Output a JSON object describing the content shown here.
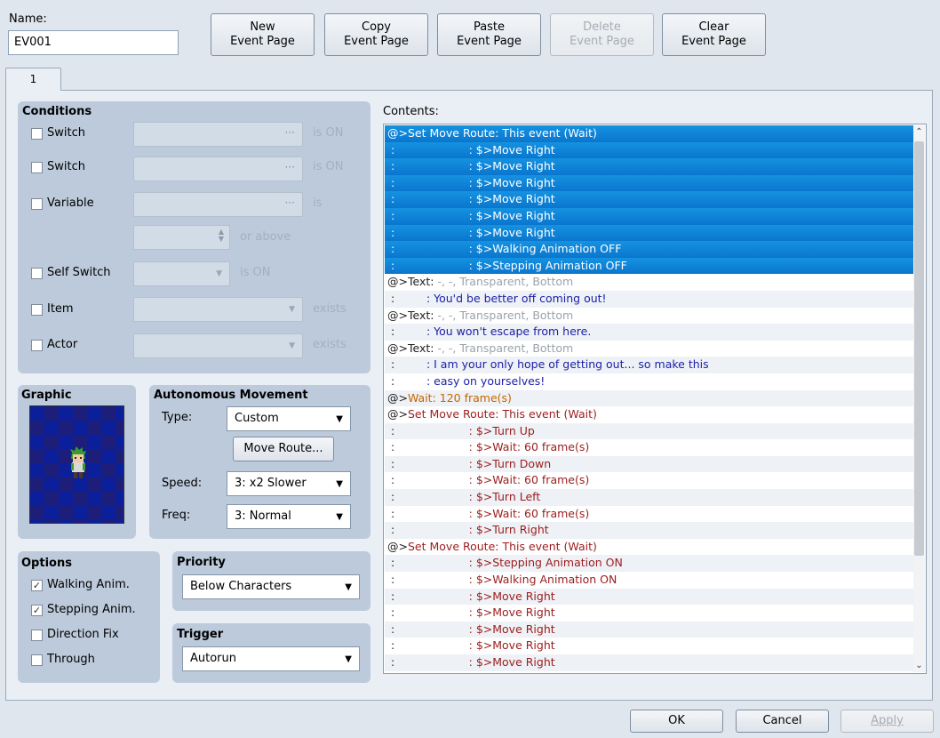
{
  "name": {
    "label": "Name:",
    "value": "EV001"
  },
  "toolbar": {
    "new": "New\nEvent Page",
    "copy": "Copy\nEvent Page",
    "paste": "Paste\nEvent Page",
    "delete": "Delete\nEvent Page",
    "clear": "Clear\nEvent Page"
  },
  "tab": {
    "label": "1"
  },
  "conditions": {
    "title": "Conditions",
    "switch1": {
      "label": "Switch",
      "suffix": "is ON"
    },
    "switch2": {
      "label": "Switch",
      "suffix": "is ON"
    },
    "variable": {
      "label": "Variable",
      "suffix": "is",
      "above": "or above"
    },
    "self_switch": {
      "label": "Self Switch",
      "suffix": "is ON"
    },
    "item": {
      "label": "Item",
      "suffix": "exists"
    },
    "actor": {
      "label": "Actor",
      "suffix": "exists"
    }
  },
  "graphic": {
    "title": "Graphic"
  },
  "movement": {
    "title": "Autonomous Movement",
    "type_label": "Type:",
    "type_value": "Custom",
    "route_button": "Move Route...",
    "speed_label": "Speed:",
    "speed_value": "3: x2 Slower",
    "freq_label": "Freq:",
    "freq_value": "3: Normal"
  },
  "options": {
    "title": "Options",
    "walking": {
      "label": "Walking Anim.",
      "checked": "✓"
    },
    "stepping": {
      "label": "Stepping Anim.",
      "checked": "✓"
    },
    "direction": {
      "label": "Direction Fix",
      "checked": ""
    },
    "through": {
      "label": "Through",
      "checked": ""
    }
  },
  "priority": {
    "title": "Priority",
    "value": "Below Characters"
  },
  "trigger": {
    "title": "Trigger",
    "value": "Autorun"
  },
  "contents": {
    "label": "Contents:",
    "rows": [
      {
        "sel": true,
        "parts": [
          {
            "t": "@>Set Move Route: This event (Wait)",
            "c": ""
          }
        ]
      },
      {
        "sel": true,
        "parts": [
          {
            "t": " :                     : $>Move Right",
            "c": ""
          }
        ]
      },
      {
        "sel": true,
        "parts": [
          {
            "t": " :                     : $>Move Right",
            "c": ""
          }
        ]
      },
      {
        "sel": true,
        "parts": [
          {
            "t": " :                     : $>Move Right",
            "c": ""
          }
        ]
      },
      {
        "sel": true,
        "parts": [
          {
            "t": " :                     : $>Move Right",
            "c": ""
          }
        ]
      },
      {
        "sel": true,
        "parts": [
          {
            "t": " :                     : $>Move Right",
            "c": ""
          }
        ]
      },
      {
        "sel": true,
        "parts": [
          {
            "t": " :                     : $>Move Right",
            "c": ""
          }
        ]
      },
      {
        "sel": true,
        "parts": [
          {
            "t": " :                     : $>Walking Animation OFF",
            "c": ""
          }
        ]
      },
      {
        "sel": true,
        "parts": [
          {
            "t": " :                     : $>Stepping Animation OFF",
            "c": ""
          }
        ]
      },
      {
        "sel": false,
        "parts": [
          {
            "t": "@>Text: ",
            "c": "c-dark"
          },
          {
            "t": "-, -, Transparent, Bottom",
            "c": "c-gray"
          }
        ]
      },
      {
        "sel": false,
        "parts": [
          {
            "t": " :         ",
            "c": "c-dark"
          },
          {
            "t": ": You'd be better off coming out!",
            "c": "c-blue"
          }
        ]
      },
      {
        "sel": false,
        "parts": [
          {
            "t": "@>Text: ",
            "c": "c-dark"
          },
          {
            "t": "-, -, Transparent, Bottom",
            "c": "c-gray"
          }
        ]
      },
      {
        "sel": false,
        "parts": [
          {
            "t": " :         ",
            "c": "c-dark"
          },
          {
            "t": ": You won't escape from here.",
            "c": "c-blue"
          }
        ]
      },
      {
        "sel": false,
        "parts": [
          {
            "t": "@>Text: ",
            "c": "c-dark"
          },
          {
            "t": "-, -, Transparent, Bottom",
            "c": "c-gray"
          }
        ]
      },
      {
        "sel": false,
        "parts": [
          {
            "t": " :         ",
            "c": "c-dark"
          },
          {
            "t": ": I am your only hope of getting out... so make this",
            "c": "c-blue"
          }
        ]
      },
      {
        "sel": false,
        "parts": [
          {
            "t": " :         ",
            "c": "c-dark"
          },
          {
            "t": ": easy on yourselves!",
            "c": "c-blue"
          }
        ]
      },
      {
        "sel": false,
        "parts": [
          {
            "t": "@>",
            "c": "c-dark"
          },
          {
            "t": "Wait: 120 frame(s)",
            "c": "c-orange"
          }
        ]
      },
      {
        "sel": false,
        "parts": [
          {
            "t": "@>",
            "c": "c-dark"
          },
          {
            "t": "Set Move Route: This event (Wait)",
            "c": "c-red"
          }
        ]
      },
      {
        "sel": false,
        "parts": [
          {
            "t": " :                     ",
            "c": "c-dark"
          },
          {
            "t": ": $>Turn Up",
            "c": "c-red"
          }
        ]
      },
      {
        "sel": false,
        "parts": [
          {
            "t": " :                     ",
            "c": "c-dark"
          },
          {
            "t": ": $>Wait: 60 frame(s)",
            "c": "c-red"
          }
        ]
      },
      {
        "sel": false,
        "parts": [
          {
            "t": " :                     ",
            "c": "c-dark"
          },
          {
            "t": ": $>Turn Down",
            "c": "c-red"
          }
        ]
      },
      {
        "sel": false,
        "parts": [
          {
            "t": " :                     ",
            "c": "c-dark"
          },
          {
            "t": ": $>Wait: 60 frame(s)",
            "c": "c-red"
          }
        ]
      },
      {
        "sel": false,
        "parts": [
          {
            "t": " :                     ",
            "c": "c-dark"
          },
          {
            "t": ": $>Turn Left",
            "c": "c-red"
          }
        ]
      },
      {
        "sel": false,
        "parts": [
          {
            "t": " :                     ",
            "c": "c-dark"
          },
          {
            "t": ": $>Wait: 60 frame(s)",
            "c": "c-red"
          }
        ]
      },
      {
        "sel": false,
        "parts": [
          {
            "t": " :                     ",
            "c": "c-dark"
          },
          {
            "t": ": $>Turn Right",
            "c": "c-red"
          }
        ]
      },
      {
        "sel": false,
        "parts": [
          {
            "t": "@>",
            "c": "c-dark"
          },
          {
            "t": "Set Move Route: This event (Wait)",
            "c": "c-red"
          }
        ]
      },
      {
        "sel": false,
        "parts": [
          {
            "t": " :                     ",
            "c": "c-dark"
          },
          {
            "t": ": $>Stepping Animation ON",
            "c": "c-red"
          }
        ]
      },
      {
        "sel": false,
        "parts": [
          {
            "t": " :                     ",
            "c": "c-dark"
          },
          {
            "t": ": $>Walking Animation ON",
            "c": "c-red"
          }
        ]
      },
      {
        "sel": false,
        "parts": [
          {
            "t": " :                     ",
            "c": "c-dark"
          },
          {
            "t": ": $>Move Right",
            "c": "c-red"
          }
        ]
      },
      {
        "sel": false,
        "parts": [
          {
            "t": " :                     ",
            "c": "c-dark"
          },
          {
            "t": ": $>Move Right",
            "c": "c-red"
          }
        ]
      },
      {
        "sel": false,
        "parts": [
          {
            "t": " :                     ",
            "c": "c-dark"
          },
          {
            "t": ": $>Move Right",
            "c": "c-red"
          }
        ]
      },
      {
        "sel": false,
        "parts": [
          {
            "t": " :                     ",
            "c": "c-dark"
          },
          {
            "t": ": $>Move Right",
            "c": "c-red"
          }
        ]
      },
      {
        "sel": false,
        "parts": [
          {
            "t": " :                     ",
            "c": "c-dark"
          },
          {
            "t": ": $>Move Right",
            "c": "c-red"
          }
        ]
      }
    ]
  },
  "footer": {
    "ok": "OK",
    "cancel": "Cancel",
    "apply": "Apply"
  },
  "colors": {
    "selection": "#0a76cf",
    "group": "#bccadb",
    "panel": "#eaeff5"
  }
}
